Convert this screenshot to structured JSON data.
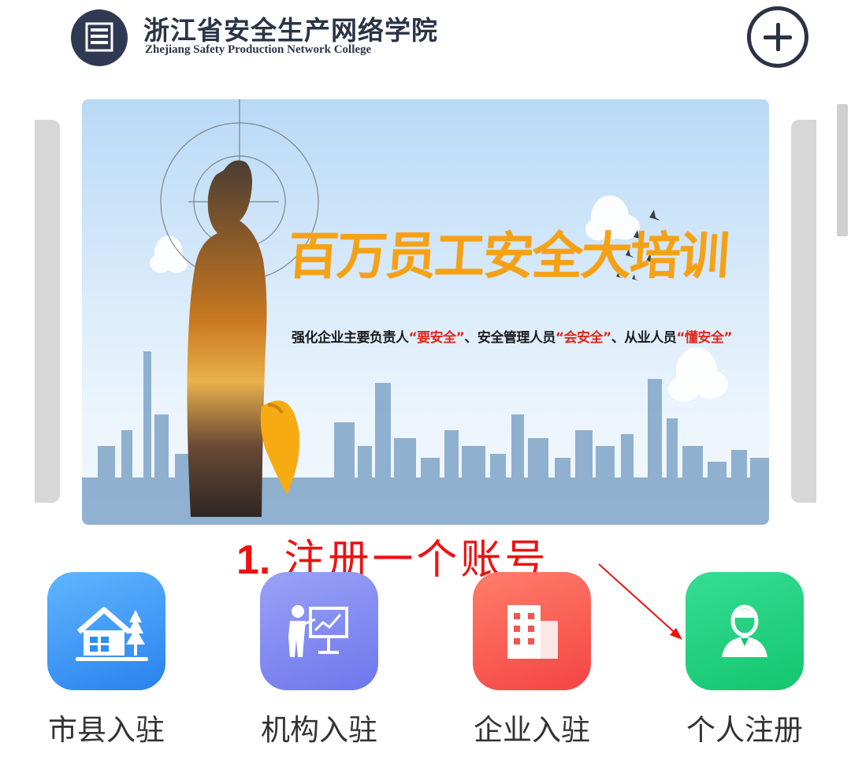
{
  "header": {
    "title_cn": "浙江省安全生产网络学院",
    "title_en": "Zhejiang Safety Production Network College",
    "logo_icon": "document-stack-icon",
    "add_icon": "plus-circle-icon"
  },
  "banner": {
    "title": "百万员工安全大培训",
    "subtitle_parts": [
      "强化企业主要负责人",
      "“要安全”",
      "、安全管理人员",
      "“会安全”",
      "、从业人员",
      "“懂安全”"
    ]
  },
  "annotation": {
    "number": "1.",
    "text": "注册一个账号"
  },
  "nav": {
    "items": [
      {
        "label": "市县入驻",
        "icon": "city-house-icon",
        "color": "#2e8ff0"
      },
      {
        "label": "机构入驻",
        "icon": "presentation-teacher-icon",
        "color": "#7b85f1"
      },
      {
        "label": "企业入驻",
        "icon": "building-icon",
        "color": "#f7534d"
      },
      {
        "label": "个人注册",
        "icon": "person-icon",
        "color": "#1fd07e"
      }
    ]
  },
  "colors": {
    "annotation_red": "#ee1111",
    "banner_title_orange": "#f5a116",
    "header_dark": "#2b3346"
  }
}
